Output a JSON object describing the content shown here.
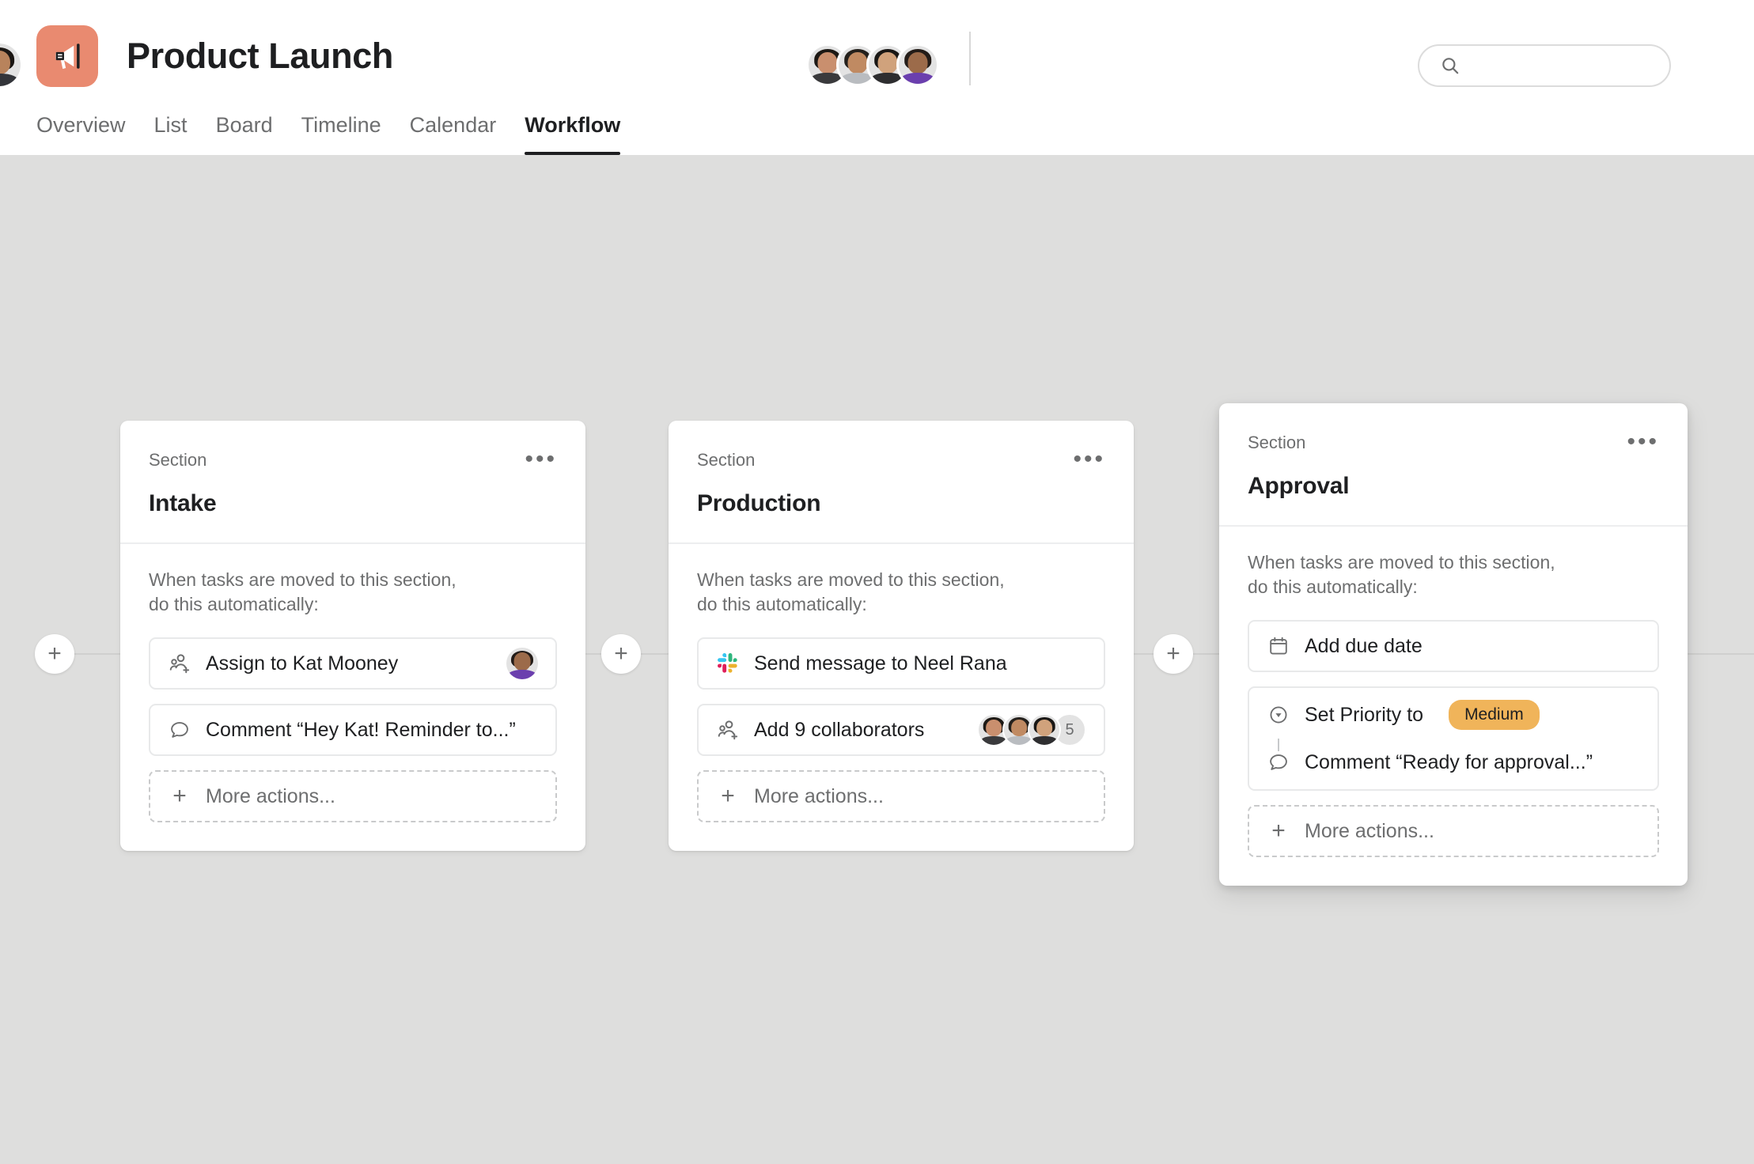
{
  "header": {
    "logo_icon": "megaphone-icon",
    "logo_color": "#e98a70",
    "project_title": "Product Launch",
    "tabs": [
      {
        "label": "Overview",
        "active": false
      },
      {
        "label": "List",
        "active": false
      },
      {
        "label": "Board",
        "active": false
      },
      {
        "label": "Timeline",
        "active": false
      },
      {
        "label": "Calendar",
        "active": false
      },
      {
        "label": "Workflow",
        "active": true
      }
    ],
    "search": {
      "value": "",
      "placeholder": "",
      "icon": "search-icon"
    },
    "members": [
      {
        "name": "",
        "style": "av-a"
      },
      {
        "name": "",
        "style": "av-b"
      },
      {
        "name": "",
        "style": "av-c"
      },
      {
        "name": "",
        "style": "av-d"
      }
    ],
    "profile": {
      "name": "",
      "style": "av-e"
    }
  },
  "canvas": {
    "add_node_glyph": "+",
    "rule_note": "When tasks are moved to this section,\ndo this automatically:",
    "more_actions_label": "More actions...",
    "more_actions_glyph": "+",
    "menu_glyph": "•••"
  },
  "sections": [
    {
      "eyebrow": "Section",
      "title": "Intake",
      "boxes": [
        {
          "rows": [
            {
              "icon": "add-people-icon",
              "label": "Assign to Kat Mooney",
              "trailing": {
                "type": "avatar",
                "style": "av-d"
              }
            }
          ]
        },
        {
          "rows": [
            {
              "icon": "comment-icon",
              "label": "Comment “Hey Kat! Reminder to...”"
            }
          ]
        }
      ]
    },
    {
      "eyebrow": "Section",
      "title": "Production",
      "boxes": [
        {
          "rows": [
            {
              "icon": "slack-icon",
              "label": "Send message to Neel Rana"
            }
          ]
        },
        {
          "rows": [
            {
              "icon": "add-people-icon",
              "label": "Add 9 collaborators",
              "trailing": {
                "type": "collaborators",
                "avatars": [
                  "av-a",
                  "av-b",
                  "av-c"
                ],
                "overflow": "5"
              }
            }
          ]
        }
      ]
    },
    {
      "eyebrow": "Section",
      "title": "Approval",
      "boxes": [
        {
          "rows": [
            {
              "icon": "calendar-icon",
              "label": "Add due date"
            }
          ]
        },
        {
          "grouped": true,
          "rows": [
            {
              "icon": "priority-icon",
              "label": "Set Priority to",
              "badge": {
                "text": "Medium",
                "color": "#f0b45a"
              }
            },
            {
              "icon": "comment-icon",
              "label": "Comment “Ready for approval...”"
            }
          ]
        }
      ]
    }
  ]
}
